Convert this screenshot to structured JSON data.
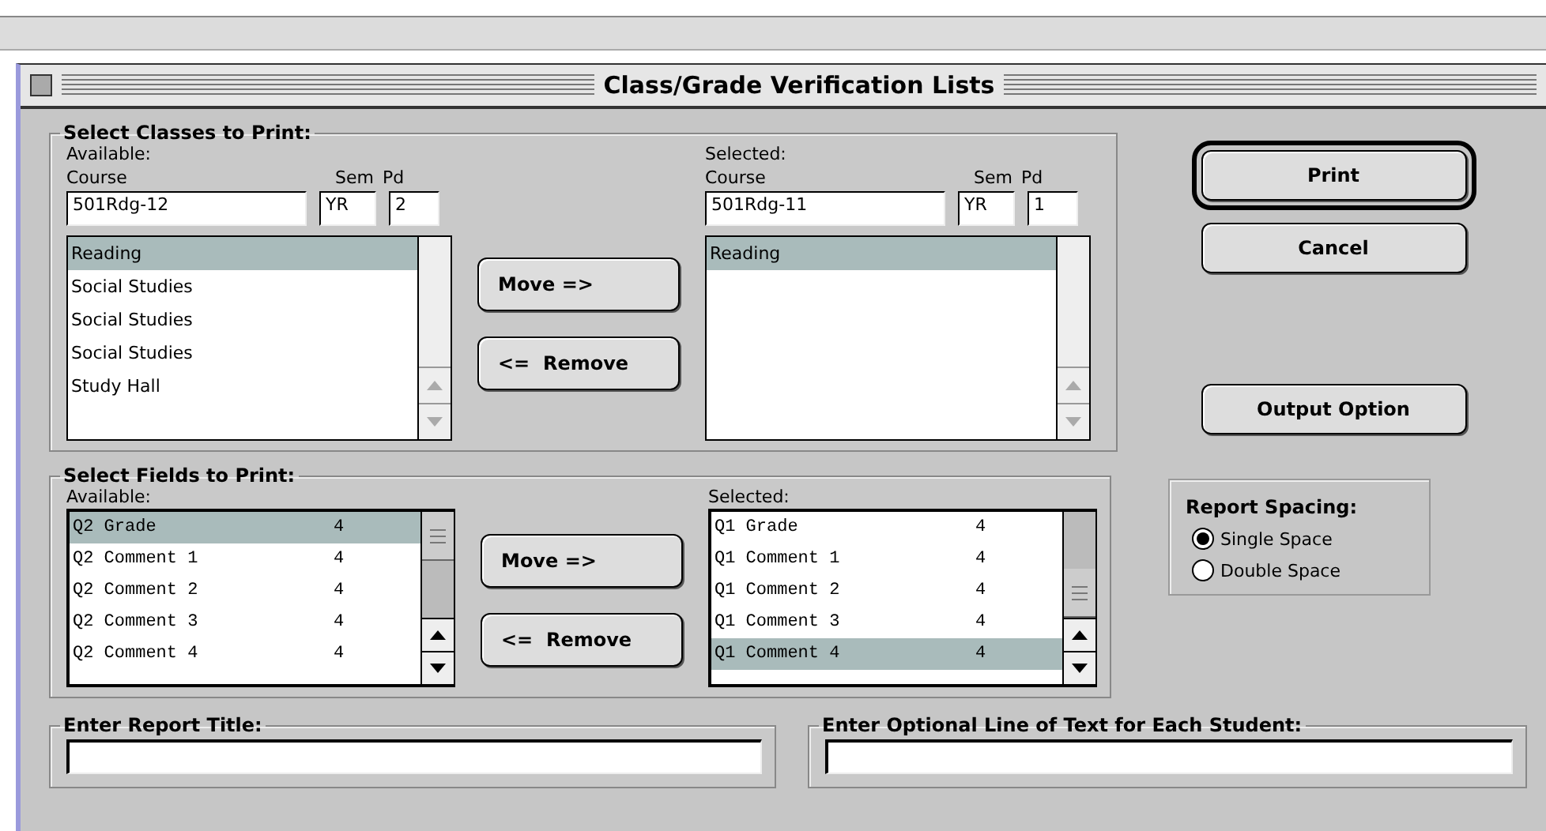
{
  "window": {
    "title": "Class/Grade Verification Lists"
  },
  "classes": {
    "title": "Select Classes to Print:",
    "available": {
      "label": "Available:",
      "course_label": "Course",
      "sem_label": "Sem",
      "pd_label": "Pd",
      "course": "501Rdg-12",
      "sem": "YR",
      "pd": "2",
      "items": [
        {
          "label": "Reading",
          "selected": true
        },
        {
          "label": "Social Studies",
          "selected": false
        },
        {
          "label": "Social Studies",
          "selected": false
        },
        {
          "label": "Social Studies",
          "selected": false
        },
        {
          "label": "Study Hall",
          "selected": false
        }
      ]
    },
    "selected": {
      "label": "Selected:",
      "course_label": "Course",
      "sem_label": "Sem",
      "pd_label": "Pd",
      "course": "501Rdg-11",
      "sem": "YR",
      "pd": "1",
      "items": [
        {
          "label": "Reading",
          "selected": true
        }
      ]
    },
    "move_button": "Move =>",
    "remove_button": "<=  Remove"
  },
  "fields": {
    "title": "Select Fields to Print:",
    "available": {
      "label": "Available:",
      "items": [
        {
          "name": "Q2 Grade",
          "size": "4",
          "selected": true
        },
        {
          "name": "Q2 Comment 1",
          "size": "4",
          "selected": false
        },
        {
          "name": "Q2 Comment 2",
          "size": "4",
          "selected": false
        },
        {
          "name": "Q2 Comment 3",
          "size": "4",
          "selected": false
        },
        {
          "name": "Q2 Comment 4",
          "size": "4",
          "selected": false
        }
      ]
    },
    "selected": {
      "label": "Selected:",
      "items": [
        {
          "name": "Q1 Grade",
          "size": "4",
          "selected": false
        },
        {
          "name": "Q1 Comment 1",
          "size": "4",
          "selected": false
        },
        {
          "name": "Q1 Comment 2",
          "size": "4",
          "selected": false
        },
        {
          "name": "Q1 Comment 3",
          "size": "4",
          "selected": false
        },
        {
          "name": "Q1 Comment 4",
          "size": "4",
          "selected": true
        }
      ]
    },
    "move_button": "Move =>",
    "remove_button": "<=  Remove"
  },
  "buttons": [
    {
      "label": "Print",
      "default": true
    },
    {
      "label": "Cancel",
      "default": false
    },
    {
      "label": "Output Option",
      "default": false
    }
  ],
  "report_spacing": {
    "title": "Report Spacing:",
    "options": [
      {
        "label": "Single Space",
        "selected": true
      },
      {
        "label": "Double Space",
        "selected": false
      }
    ]
  },
  "report_title": {
    "label": "Enter Report Title:"
  },
  "student_line": {
    "label": "Enter Optional Line of Text for Each Student:"
  }
}
